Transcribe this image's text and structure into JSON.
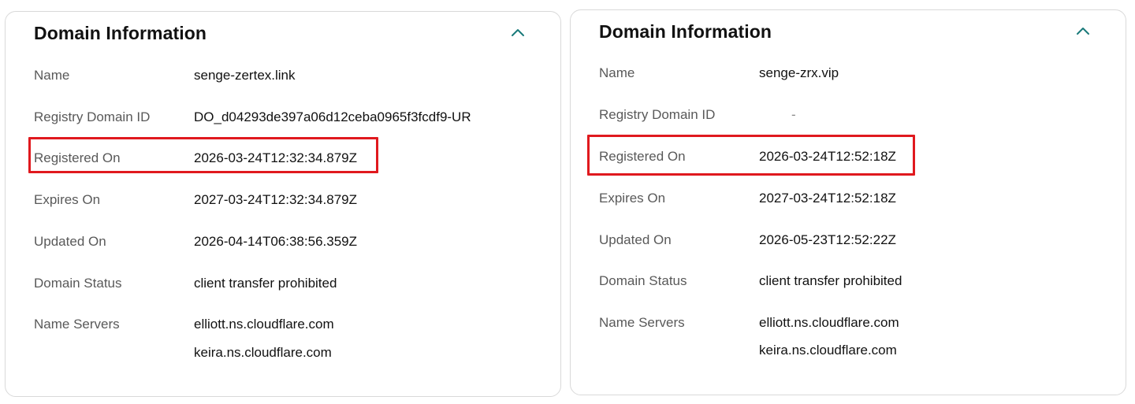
{
  "colors": {
    "chevron": "#1a7a7a",
    "highlight": "#e0191e"
  },
  "panels": [
    {
      "title": "Domain Information",
      "collapse_icon": "chevron-up-icon",
      "rows": {
        "name": {
          "label": "Name",
          "value": "senge-zertex.link"
        },
        "registry_domain_id": {
          "label": "Registry Domain ID",
          "value": "DO_d04293de397a06d12ceba0965f3fcdf9-UR"
        },
        "registered_on": {
          "label": "Registered On",
          "value": "2026-03-24T12:32:34.879Z"
        },
        "expires_on": {
          "label": "Expires On",
          "value": "2027-03-24T12:32:34.879Z"
        },
        "updated_on": {
          "label": "Updated On",
          "value": "2026-04-14T06:38:56.359Z"
        },
        "domain_status": {
          "label": "Domain Status",
          "value": "client transfer prohibited"
        },
        "name_servers": {
          "label": "Name Servers",
          "values": [
            "elliott.ns.cloudflare.com",
            "keira.ns.cloudflare.com"
          ]
        }
      }
    },
    {
      "title": "Domain Information",
      "collapse_icon": "chevron-up-icon",
      "rows": {
        "name": {
          "label": "Name",
          "value": "senge-zrx.vip"
        },
        "registry_domain_id": {
          "label": "Registry Domain ID",
          "value": "-"
        },
        "registered_on": {
          "label": "Registered On",
          "value": "2026-03-24T12:52:18Z"
        },
        "expires_on": {
          "label": "Expires On",
          "value": "2027-03-24T12:52:18Z"
        },
        "updated_on": {
          "label": "Updated On",
          "value": "2026-05-23T12:52:22Z"
        },
        "domain_status": {
          "label": "Domain Status",
          "value": "client transfer prohibited"
        },
        "name_servers": {
          "label": "Name Servers",
          "values": [
            "elliott.ns.cloudflare.com",
            "keira.ns.cloudflare.com"
          ]
        }
      }
    }
  ]
}
